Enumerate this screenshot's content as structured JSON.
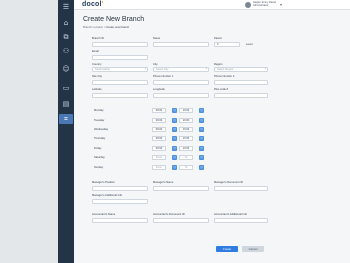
{
  "header": {
    "logo_text": "docol",
    "user_name": "Hagler Jonny Darrel",
    "user_role": "Administrator"
  },
  "sidebar": {
    "icons": [
      "menu-icon",
      "home-icon",
      "org-icon",
      "users-icon",
      "user-icon",
      "card-icon",
      "chart-icon",
      "settings-icon",
      "branch-icon"
    ],
    "active_index": 8
  },
  "page": {
    "title": "Create New Branch",
    "breadcrumb_root": "Branch Location",
    "breadcrumb_current": "Create new branch"
  },
  "form": {
    "branch_id_label": "Branch ID",
    "name_label": "Name",
    "parent_label": "Parent",
    "parent_value": "0",
    "level_label": "Level",
    "email_label": "Email",
    "country_label": "Country",
    "country_value": "Saudi Arabia",
    "city_label": "City",
    "city_value": "Select City",
    "region_label": "Region",
    "region_value": "Select Region",
    "site_city_label": "Site City",
    "phone1_label": "Phone Number 1",
    "phone2_label": "Phone Number 2",
    "latitude_label": "Latitude",
    "longitude_label": "Longitude",
    "plus_code_label": "Plus code #",
    "schedule": [
      {
        "day": "Monday",
        "from": "09:00",
        "to": "16:00",
        "active": true
      },
      {
        "day": "Tuesday",
        "from": "09:00",
        "to": "16:00",
        "active": true
      },
      {
        "day": "Wednesday",
        "from": "09:00",
        "to": "16:00",
        "active": true
      },
      {
        "day": "Thursday",
        "from": "09:00",
        "to": "16:00",
        "active": true
      },
      {
        "day": "Friday",
        "from": "09:00",
        "to": "16:00",
        "active": true
      },
      {
        "day": "Saturday",
        "from": "From",
        "to": "To",
        "active": false
      },
      {
        "day": "Sunday",
        "from": "From",
        "to": "To",
        "active": false
      }
    ],
    "mgr_position_label": "Manager's Position",
    "mgr_name_label": "Manager's Name",
    "mgr_doc_id_label": "Manager's Document ID",
    "mgr_add_info_label": "Manager's Additional Info",
    "accountant_name_label": "Accountant's Name",
    "accountant_doc_id_label": "Accountant's Document ID",
    "accountant_add_info_label": "Accountant's Additional Info"
  },
  "actions": {
    "create_label": "Create",
    "cancel_label": "Cancel"
  },
  "colors": {
    "primary": "#2f7de1",
    "rail": "#243447",
    "accent_logo": "#f0a020"
  }
}
